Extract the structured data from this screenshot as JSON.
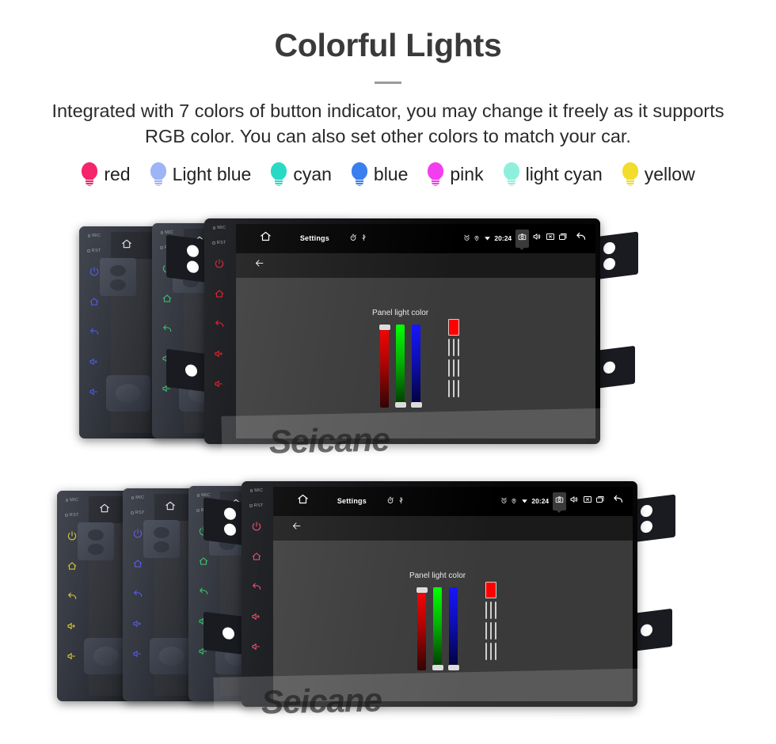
{
  "header": {
    "title": "Colorful Lights",
    "subtitle": "Integrated with 7 colors of button indicator, you may change it freely as it supports RGB color. You can also set other colors to match your car."
  },
  "legend": {
    "items": [
      {
        "label": "red",
        "color": "#f4256b",
        "icon": "bulb-icon"
      },
      {
        "label": "Light blue",
        "color": "#9db4f7",
        "icon": "bulb-icon"
      },
      {
        "label": "cyan",
        "color": "#2ad9c4",
        "icon": "bulb-icon"
      },
      {
        "label": "blue",
        "color": "#3a7ff0",
        "icon": "bulb-icon"
      },
      {
        "label": "pink",
        "color": "#f43df0",
        "icon": "bulb-icon"
      },
      {
        "label": "light cyan",
        "color": "#8ef0dc",
        "icon": "bulb-icon"
      },
      {
        "label": "yellow",
        "color": "#f2dc2c",
        "icon": "bulb-icon"
      }
    ]
  },
  "device": {
    "mic_label": "MIC",
    "rst_label": "RST",
    "buttons": [
      {
        "name": "power-button",
        "icon": "power-icon"
      },
      {
        "name": "home-button",
        "icon": "home-outline-icon"
      },
      {
        "name": "back-button",
        "icon": "back-arrow-icon"
      },
      {
        "name": "volume-up-button",
        "icon": "volume-up-icon"
      },
      {
        "name": "volume-down-button",
        "icon": "volume-down-icon"
      }
    ],
    "statusbar": {
      "home_icon": "home-icon",
      "title": "Settings",
      "alarm_icon": "stopwatch-icon",
      "usb_icon": "usb-icon",
      "clock_icon": "alarm-clock-icon",
      "location_icon": "location-pin-icon",
      "wifi_icon": "wifi-icon",
      "time": "20:24",
      "camera_icon": "camera-icon",
      "volume_icon": "speaker-icon",
      "close_icon": "close-box-icon",
      "recents_icon": "recents-icon",
      "back_icon": "back-arrow-icon"
    },
    "actionbar": {
      "back_icon": "left-arrow-icon"
    },
    "panel": {
      "title": "Panel light color",
      "sliders": [
        {
          "name": "red-slider",
          "channel": "R",
          "value_pct": 100,
          "thumb_pos_pct": 0,
          "color": "#ff0000"
        },
        {
          "name": "green-slider",
          "channel": "G",
          "value_pct": 0,
          "thumb_pos_pct": 100,
          "color": "#00ff00"
        },
        {
          "name": "blue-slider",
          "channel": "B",
          "value_pct": 0,
          "thumb_pos_pct": 100,
          "color": "#1414ff"
        }
      ],
      "preview_color": "#ff0000",
      "swatches": [
        {
          "name": "swatch-red",
          "color": "#ff0000"
        },
        {
          "name": "swatch-green",
          "color": "#00e000"
        },
        {
          "name": "swatch-blue",
          "color": "#0000f0"
        },
        {
          "name": "swatch-salmon",
          "color": "#f78b8b"
        },
        {
          "name": "swatch-lightgreen",
          "color": "#9aeea0"
        },
        {
          "name": "swatch-periwinkle",
          "color": "#9a9af5"
        },
        {
          "name": "swatch-yellow",
          "color": "#ffe800"
        },
        {
          "name": "swatch-white",
          "color": "#ffffff"
        },
        {
          "name": "swatch-rainbow",
          "color": "rainbow"
        }
      ]
    }
  },
  "rows": {
    "top": {
      "name": "top-product-row",
      "units": [
        {
          "name": "head-unit-blue",
          "indicator_color": "#2a3cf0",
          "accent": "blue"
        },
        {
          "name": "head-unit-green",
          "indicator_color": "#12c24a",
          "accent": "green"
        },
        {
          "name": "head-unit-red",
          "indicator_color": "#e01020",
          "accent": "red"
        }
      ]
    },
    "bottom": {
      "name": "bottom-product-row",
      "units": [
        {
          "name": "head-unit-yellow",
          "indicator_color": "#e8d000",
          "accent": "yellow"
        },
        {
          "name": "head-unit-blue",
          "indicator_color": "#3b3bf5",
          "accent": "blue"
        },
        {
          "name": "head-unit-green",
          "indicator_color": "#12c24a",
          "accent": "green"
        },
        {
          "name": "head-unit-red",
          "indicator_color": "#e8405a",
          "accent": "red"
        }
      ]
    }
  },
  "watermark": {
    "text": "Seicane"
  }
}
